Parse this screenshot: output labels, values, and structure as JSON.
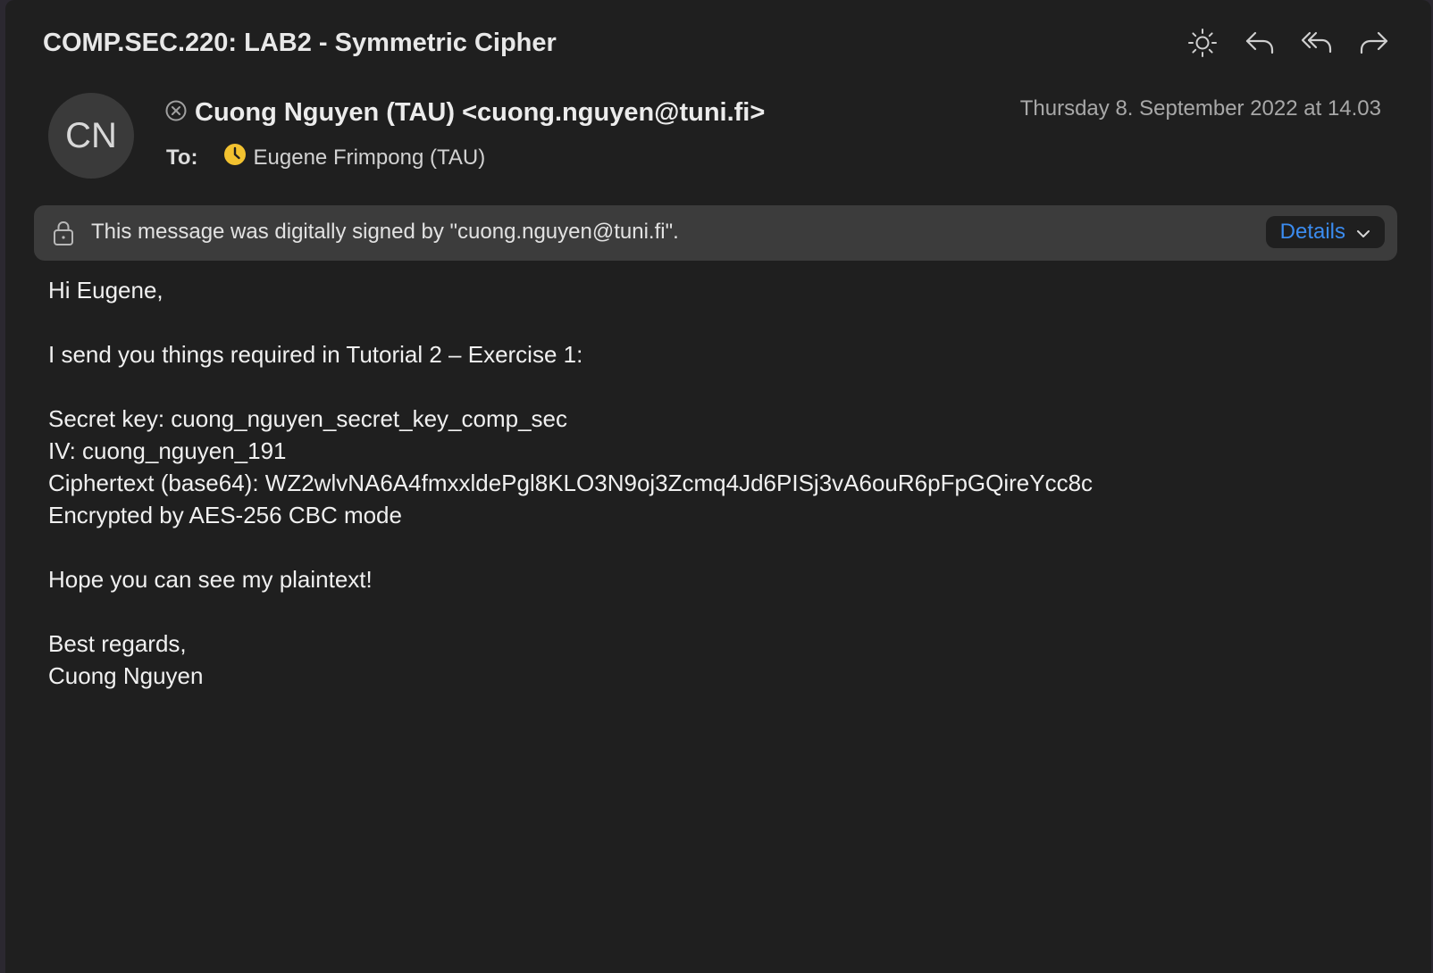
{
  "email": {
    "subject": "COMP.SEC.220: LAB2 - Symmetric Cipher",
    "avatar_initials": "CN",
    "sender": "Cuong Nguyen (TAU) <cuong.nguyen@tuni.fi>",
    "to_label": "To:",
    "recipient": "Eugene Frimpong (TAU)",
    "date": "Thursday 8. September 2022 at 14.03"
  },
  "toolbar": {
    "icons": [
      "brightness-icon",
      "reply-icon",
      "reply-all-icon",
      "forward-icon"
    ]
  },
  "signature": {
    "text": "This message was digitally signed by \"cuong.nguyen@tuni.fi\".",
    "details_label": "Details"
  },
  "body": {
    "greeting": "Hi Eugene,",
    "intro": "I send you things required in Tutorial 2 – Exercise 1:",
    "secret_key": "Secret key: cuong_nguyen_secret_key_comp_sec",
    "iv": "IV: cuong_nguyen_191",
    "ciphertext": "Ciphertext (base64): WZ2wlvNA6A4fmxxldePgl8KLO3N9oj3Zcmq4Jd6PISj3vA6ouR6pFpGQireYcc8c",
    "encryption": "Encrypted by AES-256 CBC mode",
    "closing": "Hope you can see my plaintext!",
    "regards": "Best regards,",
    "signoff": "Cuong Nguyen"
  },
  "colors": {
    "background": "#1f1f1f",
    "accent": "#3b8cf0",
    "recipient_badge": "#f2c230"
  }
}
